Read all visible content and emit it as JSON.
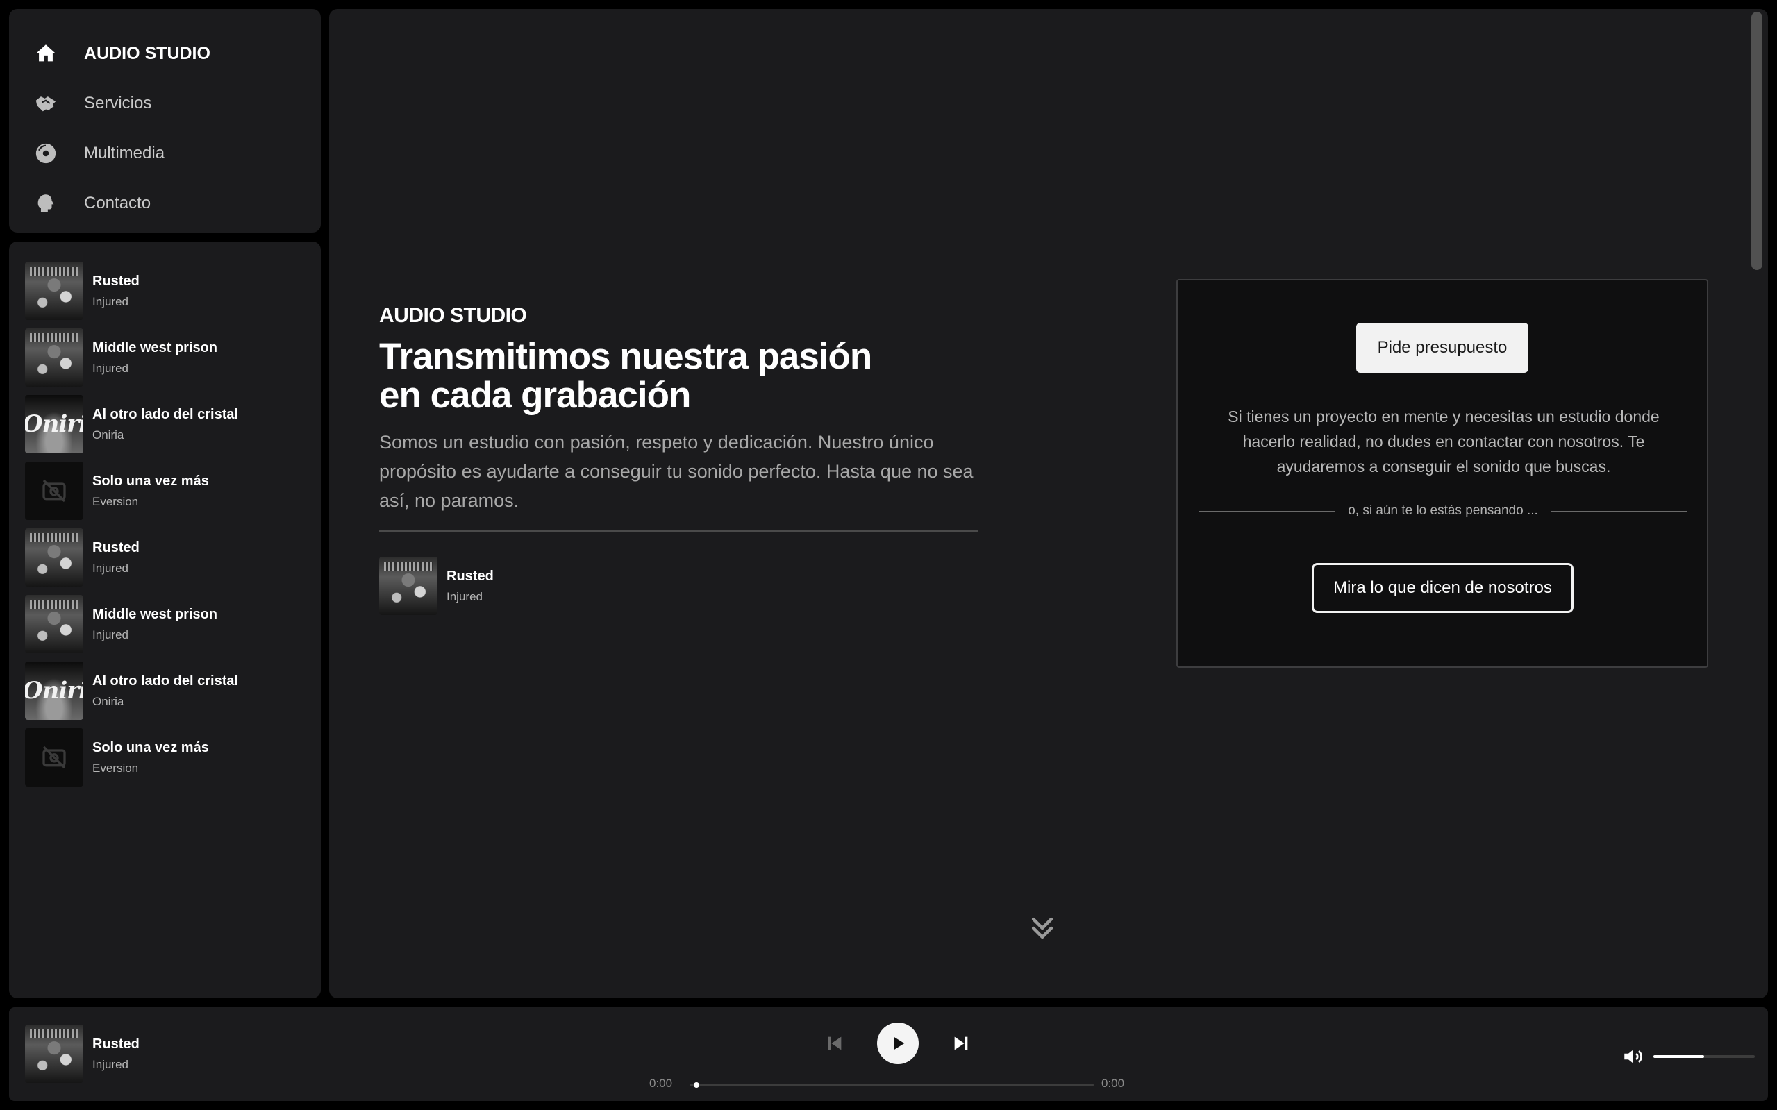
{
  "nav": {
    "items": [
      {
        "label": "AUDIO STUDIO",
        "icon": "home-icon",
        "active": true
      },
      {
        "label": "Servicios",
        "icon": "handshake-icon"
      },
      {
        "label": "Multimedia",
        "icon": "disc-icon"
      },
      {
        "label": "Contacto",
        "icon": "speaking-head-icon"
      }
    ]
  },
  "playlist": {
    "tracks": [
      {
        "title": "Rusted",
        "artist": "Injured",
        "cover": "rusted"
      },
      {
        "title": "Middle west prison",
        "artist": "Injured",
        "cover": "rusted"
      },
      {
        "title": "Al otro lado del cristal",
        "artist": "Oniria",
        "cover": "oniria"
      },
      {
        "title": "Solo una vez más",
        "artist": "Eversion",
        "cover": "empty"
      },
      {
        "title": "Rusted",
        "artist": "Injured",
        "cover": "rusted"
      },
      {
        "title": "Middle west prison",
        "artist": "Injured",
        "cover": "rusted"
      },
      {
        "title": "Al otro lado del cristal",
        "artist": "Oniria",
        "cover": "oniria"
      },
      {
        "title": "Solo una vez más",
        "artist": "Eversion",
        "cover": "empty"
      }
    ],
    "oniria_cover_text": "Oniria"
  },
  "hero": {
    "brand": "AUDIO STUDIO",
    "headline_line1": "Transmitimos nuestra pasión",
    "headline_line2": "en cada grabación",
    "description": "Somos un estudio con pasión, respeto y dedicación. Nuestro único propósito es ayudarte a conseguir tu sonido perfecto. Hasta que no sea así, no paramos.",
    "featured_track": {
      "title": "Rusted",
      "artist": "Injured"
    }
  },
  "cta": {
    "primary_label": "Pide presupuesto",
    "text": "Si tienes un proyecto en mente y necesitas un estudio donde hacerlo realidad, no dudes en contactar con nosotros. Te ayudaremos a conseguir el sonido que buscas.",
    "or_text": "o, si aún te lo estás pensando ...",
    "secondary_label": "Mira lo que dicen de nosotros"
  },
  "player": {
    "now_playing": {
      "title": "Rusted",
      "artist": "Injured"
    },
    "time_current": "0:00",
    "time_total": "0:00",
    "progress": 0.01,
    "volume": 0.5
  },
  "colors": {
    "background": "#000000",
    "panel": "#1b1b1d",
    "card": "#0f0f10",
    "text_muted": "#a8a8a8"
  }
}
